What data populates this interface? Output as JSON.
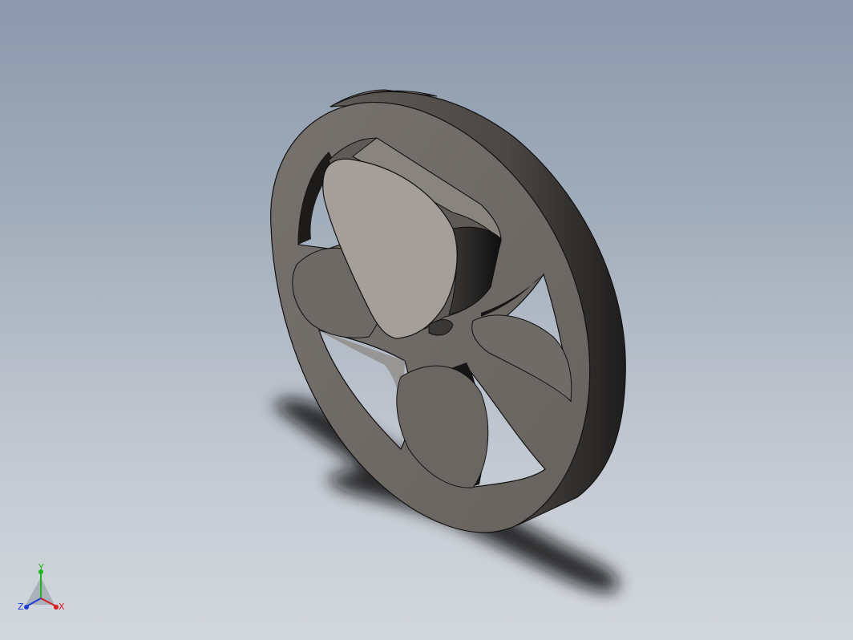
{
  "viewport": {
    "model": "fan-wheel-part",
    "background_top": "#8b99ab",
    "background_bottom": "#d3d7de",
    "part_color": "#6e6a66",
    "hub_face_color": "#a69e98"
  },
  "triad": {
    "x_label": "X",
    "y_label": "Y",
    "z_label": "Z",
    "x_color": "#d21f1f",
    "y_color": "#1fb51f",
    "z_color": "#1f3fd2"
  }
}
